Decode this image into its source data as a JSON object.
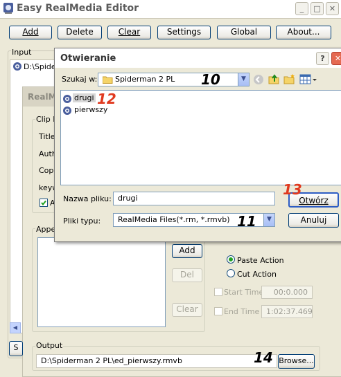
{
  "window": {
    "title": "Easy RealMedia Editor"
  },
  "toolbar": [
    {
      "name": "add-button",
      "label": "Add"
    },
    {
      "name": "delete-button",
      "label": "Delete"
    },
    {
      "name": "clear-button",
      "label": "Clear"
    },
    {
      "name": "settings-button",
      "label": "Settings"
    },
    {
      "name": "global-button",
      "label": "Global"
    },
    {
      "name": "about-button",
      "label": "About..."
    }
  ],
  "input": {
    "label": "Input",
    "first_item": "D:\\Spider"
  },
  "inner_window": {
    "title": "RealMe"
  },
  "clip_info": {
    "group": "Clip In",
    "title": "Title:",
    "author": "Auth",
    "copyright": "Copy",
    "keywords": "keyw",
    "checkbox": "A"
  },
  "append": {
    "group": "Appe",
    "add": "Add",
    "del": "Del",
    "clear": "Clear"
  },
  "actions": {
    "paste": "Paste Action",
    "cut": "Cut Action",
    "start_label": "Start Time",
    "start_value": "00:0.000",
    "end_label": "End Time",
    "end_value": "1:02:37.469"
  },
  "output": {
    "label": "Output",
    "path": "D:\\Spiderman 2 PL\\ed_pierwszy.rmvb",
    "browse": "Browse..."
  },
  "bottom_left": "S",
  "dialog": {
    "title": "Otwieranie",
    "look_in_label": "Szukaj w:",
    "look_in_value": "Spiderman 2 PL",
    "files": [
      {
        "name": "drugi",
        "selected": true
      },
      {
        "name": "pierwszy",
        "selected": false
      }
    ],
    "filename_label": "Nazwa pliku:",
    "filename_value": "drugi",
    "filetype_label": "Pliki typu:",
    "filetype_value": "RealMedia Files(*.rm, *.rmvb)",
    "open": "Otwórz",
    "cancel": "Anuluj"
  },
  "annotations": [
    "10",
    "11",
    "12",
    "13",
    "14"
  ]
}
